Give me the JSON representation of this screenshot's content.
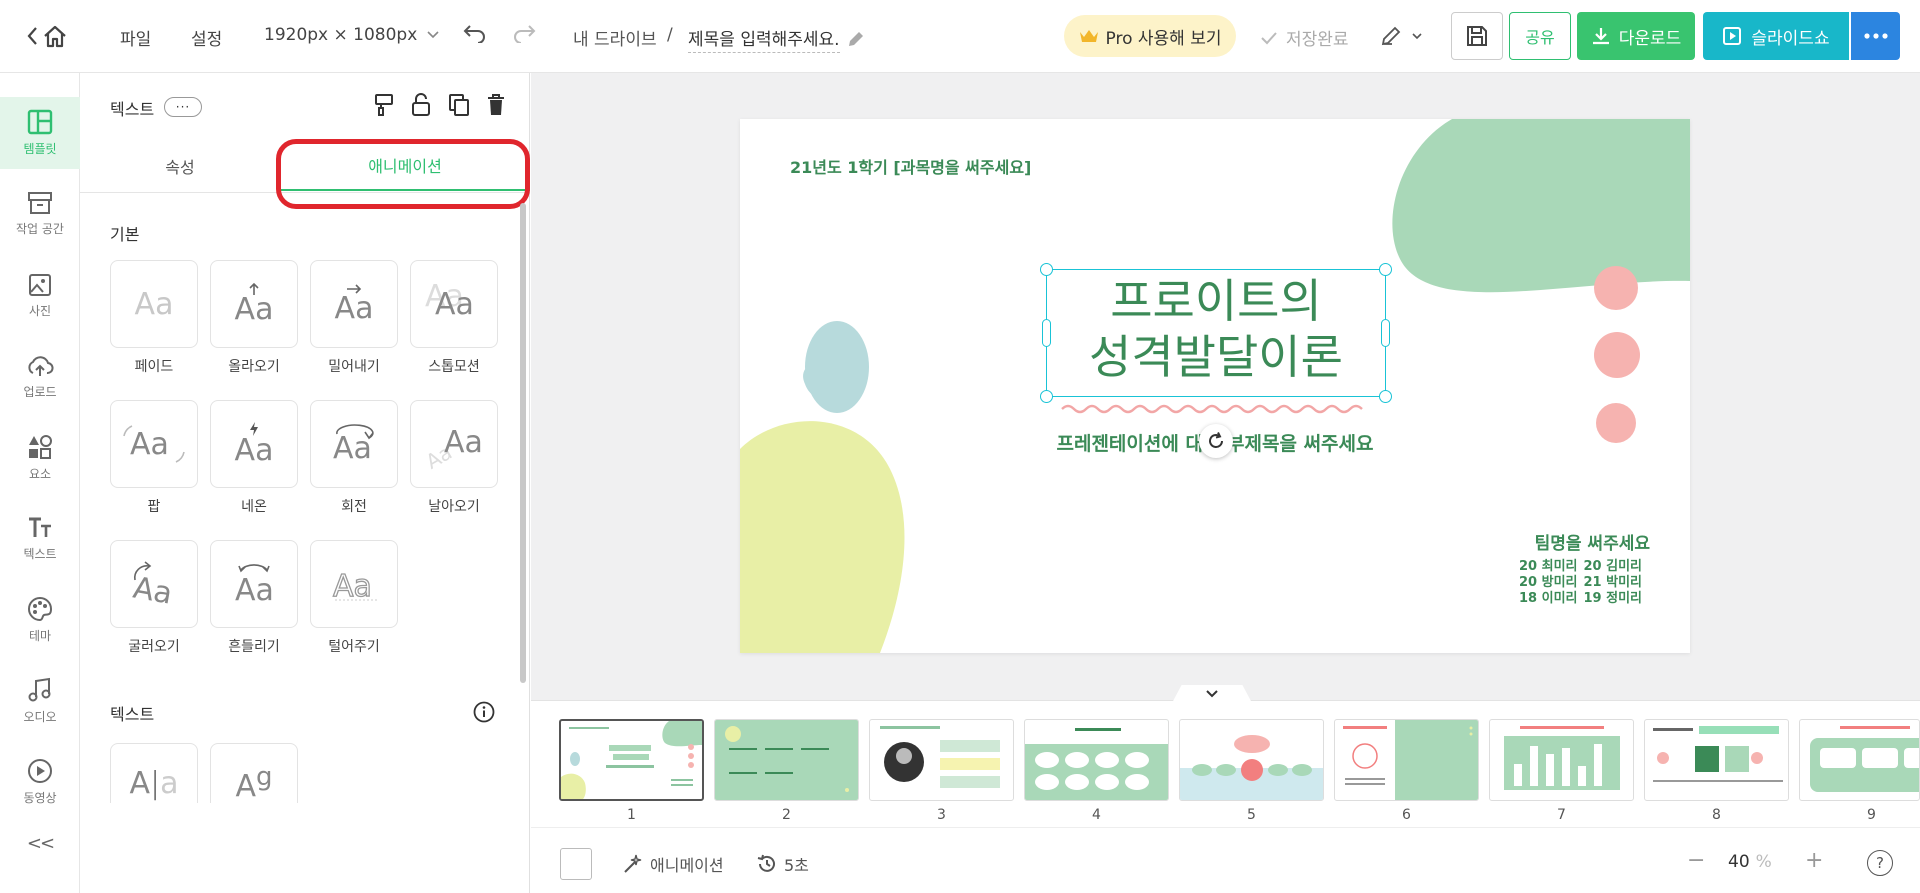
{
  "topbar": {
    "menu_file": "파일",
    "menu_settings": "설정",
    "canvas_size": "1920px × 1080px",
    "breadcrumb_drive": "내 드라이브",
    "breadcrumb_sep": "/",
    "doc_title_placeholder": "제목을 입력해주세요.",
    "pro_label": "Pro 사용해 보기",
    "save_status": "저장완료",
    "share_label": "공유",
    "download_label": "다운로드",
    "slideshow_label": "슬라이드쇼"
  },
  "leftnav": {
    "items": [
      {
        "label": "템플릿",
        "icon": "template-icon"
      },
      {
        "label": "작업 공간",
        "icon": "workspace-icon"
      },
      {
        "label": "사진",
        "icon": "photo-icon"
      },
      {
        "label": "업로드",
        "icon": "upload-icon"
      },
      {
        "label": "요소",
        "icon": "elements-icon"
      },
      {
        "label": "텍스트",
        "icon": "text-icon"
      },
      {
        "label": "테마",
        "icon": "theme-icon"
      },
      {
        "label": "오디오",
        "icon": "audio-icon"
      },
      {
        "label": "동영상",
        "icon": "video-icon"
      }
    ],
    "collapse": "<<"
  },
  "panel": {
    "title": "텍스트",
    "more": "···",
    "tabs": [
      "속성",
      "애니메이션"
    ],
    "active_tab": "애니메이션",
    "section_basic": "기본",
    "section_text": "텍스트",
    "basic_animations": [
      "페이드",
      "올라오기",
      "밀어내기",
      "스톱모션",
      "팝",
      "네온",
      "회전",
      "날아오기",
      "굴러오기",
      "흔들리기",
      "털어주기"
    ],
    "text_animation_glyphs": [
      "A",
      "A"
    ]
  },
  "slide": {
    "course": "21년도 1학기 [과목명을 써주세요]",
    "title_line1": "프로이트의",
    "title_line2": "성격발달이론",
    "subtitle": "프레젠테이션에 대한 부제목을 써주세요",
    "team": "팀명을 써주세요",
    "members": [
      "20 최미리",
      "20 김미리",
      "20 방미리",
      "21 박미리",
      "18 이미리",
      "19 정미리"
    ]
  },
  "filmstrip": {
    "pages": [
      "1",
      "2",
      "3",
      "4",
      "5",
      "6",
      "7",
      "8",
      "9"
    ],
    "active": "1"
  },
  "bottombar": {
    "animation_label": "애니메이션",
    "duration": "5초",
    "zoom_value": "40",
    "zoom_unit": "%",
    "help": "?"
  },
  "colors": {
    "accent_green": "#2fbf71",
    "slide_green": "#3b8a57",
    "blob_mint": "#a9d8b8",
    "blob_pink": "#f6b3b0",
    "blob_yellow": "#e8efa6",
    "blob_blue": "#b7dadc",
    "selection": "#19c3d6",
    "highlight_red": "#e0262d"
  }
}
